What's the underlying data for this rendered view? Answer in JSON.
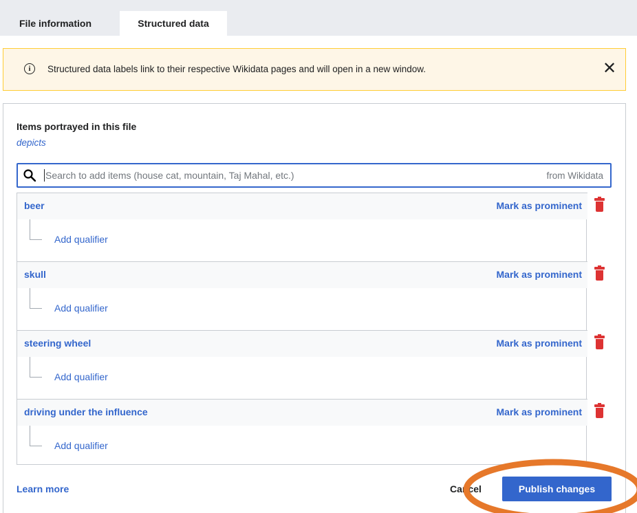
{
  "tabs": [
    {
      "label": "File information"
    },
    {
      "label": "Structured data"
    }
  ],
  "notice": {
    "info_glyph": "i",
    "text": "Structured data labels link to their respective Wikidata pages and will open in a new window.",
    "close_glyph": "✕"
  },
  "section": {
    "title": "Items portrayed in this file",
    "property": "depicts"
  },
  "search": {
    "placeholder": "Search to add items (house cat, mountain, Taj Mahal, etc.)",
    "value": "",
    "source": "from Wikidata"
  },
  "items": [
    {
      "label": "beer",
      "prominent": "Mark as prominent",
      "qualifier": "Add qualifier"
    },
    {
      "label": "skull",
      "prominent": "Mark as prominent",
      "qualifier": "Add qualifier"
    },
    {
      "label": "steering wheel",
      "prominent": "Mark as prominent",
      "qualifier": "Add qualifier"
    },
    {
      "label": "driving under the influence",
      "prominent": "Mark as prominent",
      "qualifier": "Add qualifier"
    }
  ],
  "footer": {
    "learn_more": "Learn more",
    "cancel": "Cancel",
    "publish": "Publish changes"
  },
  "colors": {
    "link": "#3366cc",
    "delete": "#d33333",
    "notice_bg": "#fef6e7",
    "notice_border": "#ffcc33",
    "highlight_ring": "#e6782a"
  },
  "icons": [
    "info-icon",
    "close-icon",
    "search-icon",
    "trash-icon"
  ]
}
